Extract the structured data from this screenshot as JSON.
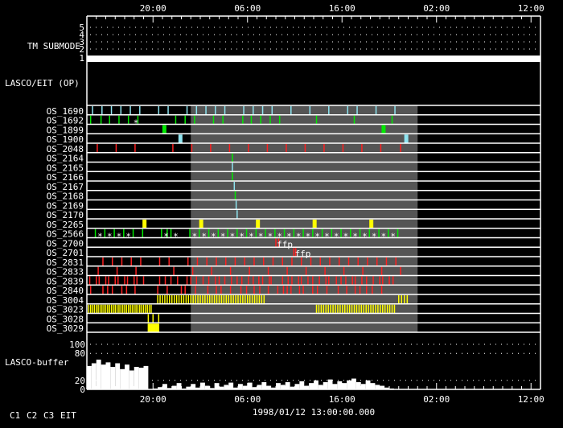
{
  "chart_data": {
    "type": "timeline",
    "title": "1998/01/12 13:00:00.000",
    "time_range_hours": [
      0,
      48
    ],
    "x_ticks": [
      {
        "hour": 7,
        "label": "20:00"
      },
      {
        "hour": 17,
        "label": "06:00"
      },
      {
        "hour": 27,
        "label": "16:00"
      },
      {
        "hour": 37,
        "label": "02:00"
      },
      {
        "hour": 47,
        "label": "12:00"
      }
    ],
    "highlight_range_hours": [
      11,
      35
    ],
    "tm_submode": {
      "label": "TM SUBMODE",
      "levels": [
        "5",
        "4",
        "3",
        "2",
        "1"
      ],
      "value": 1
    },
    "section_label": "LASCO/EIT (OP)",
    "colors": {
      "c1": "#ff2020",
      "c2": "#00e800",
      "c3": "#8ee4f0",
      "eit": "#ffff00",
      "star": "#ffffff",
      "highlight": "#555555"
    },
    "legend": [
      {
        "key": "c1",
        "label": "C1"
      },
      {
        "key": "c2",
        "label": "C2"
      },
      {
        "key": "c3",
        "label": "C3"
      },
      {
        "key": "eit",
        "label": "EIT"
      }
    ],
    "rows": [
      {
        "name": "OS_1690",
        "color": "c3",
        "marks": [
          0.6,
          1.6,
          2.6,
          3.6,
          4.6,
          5.6,
          7.6,
          8.6,
          10.6,
          11.6,
          12.6,
          13.6,
          14.6,
          16.6,
          17.6,
          18.6,
          19.6,
          21.6,
          23.6,
          25.6,
          27.6,
          28.6,
          30.6,
          32.6
        ]
      },
      {
        "name": "OS_1692",
        "color": "c2",
        "marks": [
          0.4,
          1.5,
          2.4,
          3.4,
          4.4,
          5.4,
          9.4,
          10.4,
          11.4,
          13.4,
          14.4,
          16.5,
          17.4,
          18.4,
          19.4,
          20.4,
          24.3,
          28.3,
          32.3
        ],
        "stars": [
          5.2
        ]
      },
      {
        "name": "OS_1899",
        "color": "c2",
        "marks": [
          8.2,
          31.4
        ],
        "thick": true
      },
      {
        "name": "OS_1900",
        "color": "c3",
        "marks": [
          9.9,
          33.8
        ],
        "thick": true
      },
      {
        "name": "OS_2048",
        "color": "c1",
        "marks": [
          1.1,
          3.1,
          5.1,
          9.1,
          11.1,
          13.1,
          15.1,
          17.1,
          19.1,
          21.1,
          23.1,
          25.1,
          27.1,
          29.1,
          31.1,
          33.2
        ]
      },
      {
        "name": "OS_2164",
        "color": "c2",
        "marks": [
          15.4
        ]
      },
      {
        "name": "OS_2165",
        "color": "c3",
        "marks": [
          15.4
        ]
      },
      {
        "name": "OS_2166",
        "color": "c2",
        "marks": [
          15.4
        ]
      },
      {
        "name": "OS_2167",
        "color": "c3",
        "marks": [
          15.6
        ]
      },
      {
        "name": "OS_2168",
        "color": "c2",
        "marks": [
          15.7
        ]
      },
      {
        "name": "OS_2169",
        "color": "c3",
        "marks": [
          15.8
        ]
      },
      {
        "name": "OS_2170",
        "color": "c3",
        "marks": [
          15.9
        ]
      },
      {
        "name": "OS_2265",
        "color": "eit",
        "marks": [
          6.1,
          12.1,
          18.1,
          24.1,
          30.1
        ],
        "thick": true
      },
      {
        "name": "OS_2566",
        "color": "c2",
        "marks": [
          0.9,
          1.9,
          2.9,
          3.9,
          4.9,
          5.9,
          7.9,
          8.5,
          8.9,
          10.9,
          11.9,
          12.9,
          13.9,
          14.9,
          15.9,
          16.9,
          17.9,
          18.9,
          19.9,
          20.9,
          21.9,
          22.9,
          23.9,
          24.9,
          25.9,
          26.9,
          27.9,
          28.9,
          29.9,
          30.9,
          31.9,
          32.9
        ],
        "stars": [
          1.4,
          2.4,
          3.4,
          4.4,
          8.4,
          9.4,
          11.4,
          12.4,
          13.4,
          14.4,
          15.4,
          16.4,
          17.4,
          18.4,
          19.4,
          20.4,
          21.4,
          22.4,
          23.4,
          24.4,
          25.4,
          26.4,
          27.4,
          28.4,
          29.4,
          30.4,
          31.4,
          32.4
        ]
      },
      {
        "name": "OS_2700",
        "color": "c1",
        "marks": [
          20.0,
          20.3
        ],
        "note": {
          "hour": 20.1,
          "text": "ffp"
        }
      },
      {
        "name": "OS_2701",
        "color": "c1",
        "marks": [
          21.9,
          22.1
        ],
        "note": {
          "hour": 22.0,
          "text": "ffp"
        }
      },
      {
        "name": "OS_2831",
        "color": "c1",
        "marks": [
          1.7,
          2.7,
          3.7,
          4.7,
          5.7,
          7.7,
          8.7,
          10.7,
          11.7,
          12.7,
          13.7,
          14.7,
          15.7,
          16.7,
          17.7,
          18.7,
          19.7,
          20.7,
          21.7,
          22.7,
          23.7,
          24.7,
          25.7,
          26.7,
          27.7,
          28.7,
          29.7,
          30.7,
          31.7,
          32.7
        ]
      },
      {
        "name": "OS_2833",
        "color": "c1",
        "marks": [
          1.2,
          3.2,
          5.2,
          9.2,
          11.2,
          13.2,
          15.2,
          17.2,
          19.2,
          21.2,
          23.2,
          25.2,
          27.2,
          29.2,
          31.2,
          33.2
        ]
      },
      {
        "name": "OS_2839",
        "color": "c1",
        "marks": [
          0.3,
          1.0,
          1.3,
          2.0,
          2.3,
          3.0,
          3.3,
          4.0,
          4.3,
          5.0,
          5.3,
          6.0,
          7.7,
          8.3,
          8.9,
          9.6,
          10.6,
          11.0,
          11.6,
          12.3,
          12.9,
          13.6,
          14.0,
          14.6,
          15.3,
          15.9,
          16.4,
          17.1,
          17.6,
          18.2,
          18.6,
          19.3,
          19.5,
          20.7,
          21.3,
          21.7,
          22.4,
          22.7,
          23.4,
          23.9,
          24.6,
          25.3,
          25.6,
          26.4,
          26.9,
          27.4,
          28.1,
          28.4,
          29.1,
          29.6,
          30.3,
          31.0,
          31.3,
          32.0,
          32.4
        ]
      },
      {
        "name": "OS_2840",
        "color": "c1",
        "marks": [
          0.4,
          1.7,
          2.2,
          2.7,
          3.7,
          4.2,
          5.1,
          7.5,
          8.5,
          10.0,
          10.4,
          11.5,
          12.8,
          13.7,
          14.2,
          15.2,
          16.3,
          16.9,
          17.7,
          18.3,
          19.2,
          20.2,
          20.8,
          21.2,
          21.6,
          22.5,
          22.9,
          23.9,
          24.4,
          25.4,
          26.6,
          27.5,
          28.4,
          28.9,
          29.6,
          30.2,
          31.2
        ]
      },
      {
        "name": "OS_3004",
        "color": "eit",
        "ranges": [
          {
            "from": 7.5,
            "to": 18.8,
            "step": 0.25
          },
          {
            "from": 33.0,
            "to": 33.9,
            "step": 0.3
          }
        ]
      },
      {
        "name": "OS_3023",
        "color": "eit",
        "ranges": [
          {
            "from": 0.2,
            "to": 6.9,
            "step": 0.2
          },
          {
            "from": 24.3,
            "to": 32.7,
            "step": 0.25
          }
        ]
      },
      {
        "name": "OS_3028",
        "color": "eit",
        "marks": [
          6.5,
          7.0,
          7.6
        ]
      },
      {
        "name": "OS_3029",
        "color": "eit",
        "ranges": [
          {
            "from": 6.5,
            "to": 7.6,
            "step": 0.1
          }
        ]
      }
    ],
    "buffer": {
      "label": "LASCO-buffer",
      "ylim": [
        0,
        100
      ],
      "y_ticks": [
        "0",
        "20",
        "80",
        "100"
      ],
      "y_tick_values": [
        0,
        20,
        80,
        100
      ],
      "bin_hours": 0.5,
      "values": [
        52,
        58,
        66,
        55,
        60,
        50,
        58,
        45,
        55,
        42,
        50,
        48,
        52,
        0,
        2,
        5,
        12,
        3,
        8,
        14,
        2,
        6,
        12,
        4,
        15,
        8,
        3,
        14,
        6,
        10,
        15,
        4,
        12,
        8,
        15,
        5,
        10,
        16,
        8,
        4,
        14,
        10,
        16,
        6,
        12,
        18,
        8,
        14,
        20,
        10,
        16,
        22,
        12,
        18,
        14,
        20,
        24,
        16,
        12,
        20,
        14,
        10,
        8,
        4,
        2,
        0,
        0
      ]
    }
  }
}
